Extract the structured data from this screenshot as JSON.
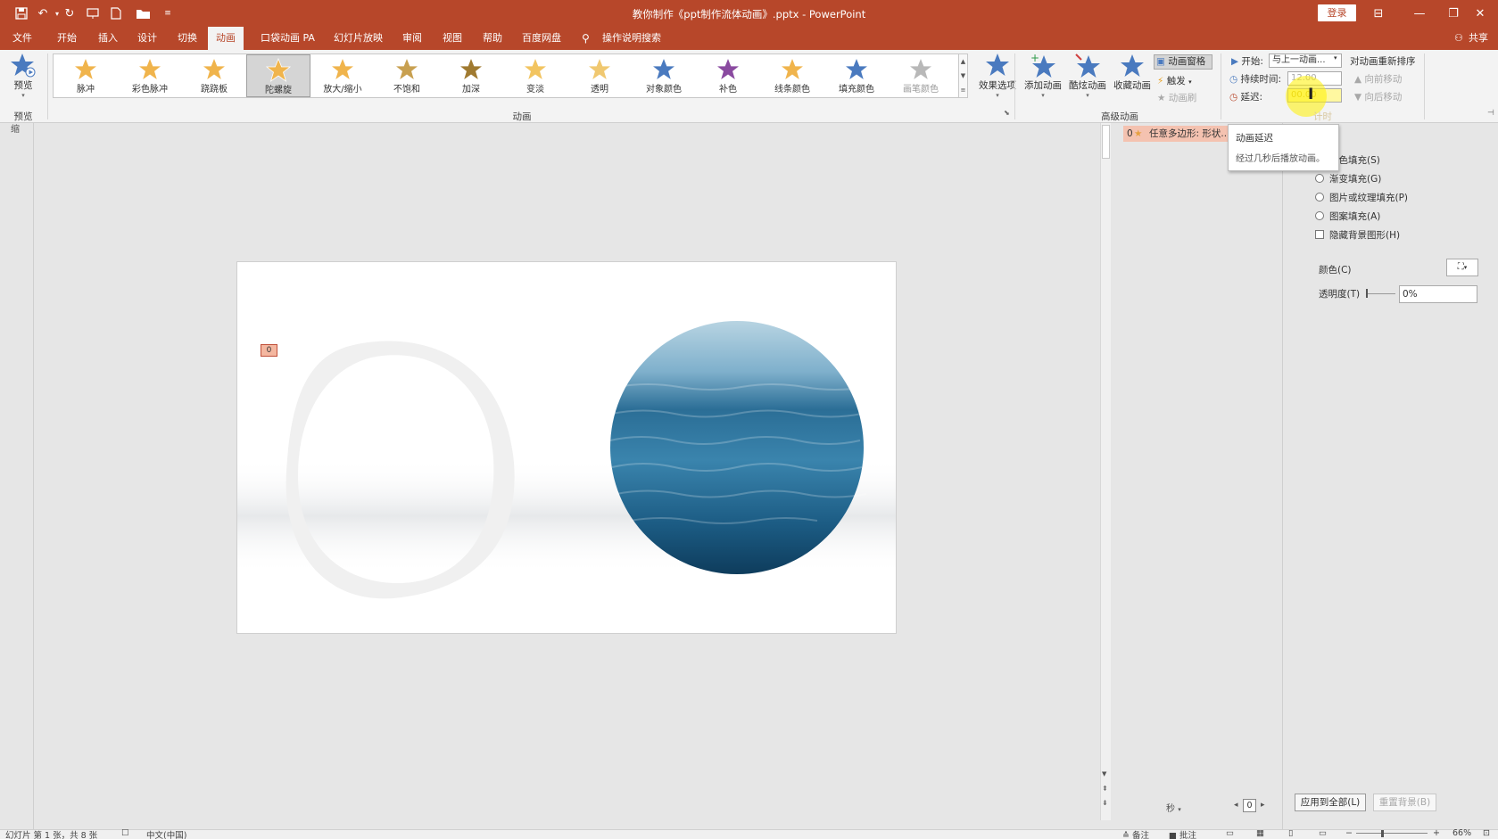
{
  "window": {
    "title": "教你制作《ppt制作流体动画》.pptx  -  PowerPoint",
    "login": "登录"
  },
  "quick_access": {
    "icons": [
      "save-icon",
      "undo-icon",
      "redo-icon",
      "presenter-icon",
      "new-file-icon",
      "open-folder-icon",
      "customize-icon"
    ]
  },
  "menu": {
    "tabs": [
      "文件",
      "开始",
      "插入",
      "设计",
      "切换",
      "动画",
      "口袋动画 PA",
      "幻灯片放映",
      "审阅",
      "视图",
      "帮助",
      "百度网盘"
    ],
    "active": "动画",
    "tell_me": "操作说明搜索",
    "share": "共享"
  },
  "ribbon": {
    "preview": {
      "label": "预览",
      "group": "预览"
    },
    "animations": [
      {
        "label": "脉冲",
        "color": "#f0b44c"
      },
      {
        "label": "彩色脉冲",
        "color": "#f0b44c"
      },
      {
        "label": "跷跷板",
        "color": "#f0b44c"
      },
      {
        "label": "陀螺旋",
        "color": "#f0b44c",
        "selected": true
      },
      {
        "label": "放大/缩小",
        "color": "#f0b44c"
      },
      {
        "label": "不饱和",
        "color": "#c8a050"
      },
      {
        "label": "加深",
        "color": "#a07a30"
      },
      {
        "label": "变淡",
        "color": "#f2c460"
      },
      {
        "label": "透明",
        "color": "#f0c870"
      },
      {
        "label": "对象颜色",
        "color": "#4a7abf"
      },
      {
        "label": "补色",
        "color": "#8a4aa0"
      },
      {
        "label": "线条颜色",
        "color": "#f0b44c"
      },
      {
        "label": "填充颜色",
        "color": "#4a7abf"
      },
      {
        "label": "画笔颜色",
        "color": "#b8b8b8",
        "disabled": true
      }
    ],
    "effect_options": "效果选项",
    "group_animation": "动画",
    "advanced": {
      "add": "添加动画",
      "cool": "酷炫动画",
      "collect": "收藏动画",
      "pane": "动画窗格",
      "trigger": "触发",
      "painter": "动画刷",
      "group": "高级动画"
    },
    "timing": {
      "start_label": "开始:",
      "start_value": "与上一动画...",
      "duration_label": "持续时间:",
      "duration_value": "12.00",
      "delay_label": "延迟:",
      "delay_value": "00.00",
      "reorder": "对动画重新排序",
      "move_earlier": "向前移动",
      "move_later": "向后移动",
      "group": "计时"
    }
  },
  "tooltip": {
    "title": "动画延迟",
    "desc": "经过几秒后播放动画。"
  },
  "animation_pane": {
    "item_number": "0",
    "item_label": "任意多边形: 形状...",
    "seconds": "秒",
    "counter": "0"
  },
  "background_pane": {
    "fill_options": [
      "纯色填充(S)",
      "渐变填充(G)",
      "图片或纹理填充(P)",
      "图案填充(A)"
    ],
    "hide_bg": "隐藏背景图形(H)",
    "color_label": "颜色(C)",
    "transparency_label": "透明度(T)",
    "transparency_value": "0%",
    "apply_all": "应用到全部(L)",
    "reset_bg": "重置背景(B)"
  },
  "slide": {
    "anim_tag": "0"
  },
  "left_strip": {
    "label": "缩"
  },
  "status": {
    "slide_info": "幻灯片 第 1 张，共 8 张",
    "language": "中文(中国)",
    "notes": "备注",
    "comments": "批注",
    "zoom": "66%"
  }
}
